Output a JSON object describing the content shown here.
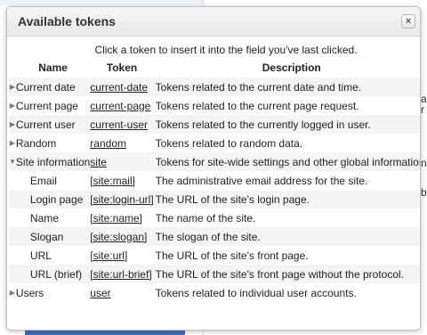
{
  "background": {
    "right_fragments": [
      "a",
      "r",
      "n",
      "b"
    ]
  },
  "dialog": {
    "title": "Available tokens",
    "close_label": "×",
    "instructions": "Click a token to insert it into the field you've last clicked.",
    "columns": {
      "name": "Name",
      "token": "Token",
      "description": "Description"
    },
    "rows": [
      {
        "toggle": "▶",
        "name": "Current date",
        "token": "current-date",
        "description": "Tokens related to the current date and time."
      },
      {
        "toggle": "▶",
        "name": "Current page",
        "token": "current-page",
        "description": "Tokens related to the current page request."
      },
      {
        "toggle": "▶",
        "name": "Current user",
        "token": "current-user",
        "description": "Tokens related to the currently logged in user."
      },
      {
        "toggle": "▶",
        "name": "Random",
        "token": "random",
        "description": "Tokens related to random data."
      },
      {
        "toggle": "▼",
        "name": "Site information",
        "token": "site",
        "description": "Tokens for site-wide settings and other global information."
      },
      {
        "toggle": "",
        "name": "Email",
        "token": "[site:mail]",
        "description": "The administrative email address for the site."
      },
      {
        "toggle": "",
        "name": "Login page",
        "token": "[site:login-url]",
        "description": "The URL of the site's login page."
      },
      {
        "toggle": "",
        "name": "Name",
        "token": "[site:name]",
        "description": "The name of the site."
      },
      {
        "toggle": "",
        "name": "Slogan",
        "token": "[site:slogan]",
        "description": "The slogan of the site."
      },
      {
        "toggle": "",
        "name": "URL",
        "token": "[site:url]",
        "description": "The URL of the site's front page."
      },
      {
        "toggle": "",
        "name": "URL (brief)",
        "token": "[site:url-brief]",
        "description": "The URL of the site's front page without the protocol."
      },
      {
        "toggle": "▶",
        "name": "Users",
        "token": "user",
        "description": "Tokens related to individual user accounts."
      }
    ]
  }
}
